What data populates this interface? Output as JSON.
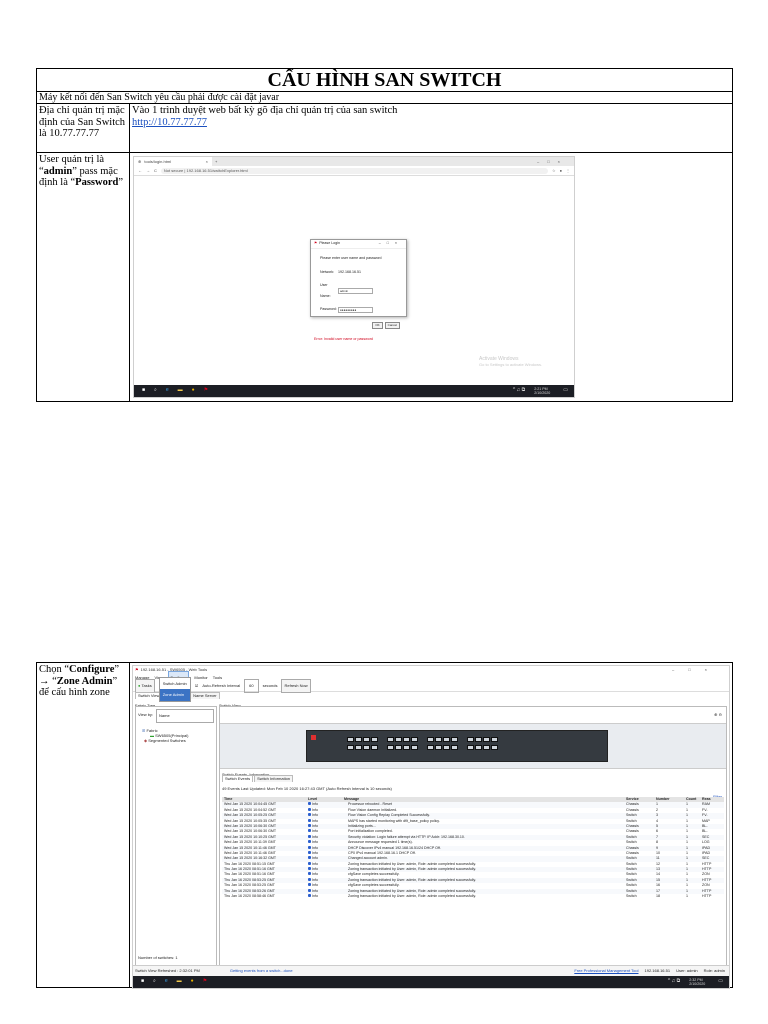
{
  "doc": {
    "title": "CẤU HÌNH SAN SWITCH",
    "note": "Máy kết nối đến San Switch yêu cầu phải được cài đặt javar",
    "row1": {
      "left": "Địa chỉ quản trị mặc định của San Switch là 10.77.77.77",
      "right": "Vào 1 trình duyệt web bất kỳ gõ địa chỉ quản trị của san switch",
      "link": "http://10.77.77.77"
    },
    "row2": {
      "left_pre": "User quản trị là “",
      "left_user": "admin",
      "left_mid": "” pass mặc định là “",
      "left_pass": "Password",
      "left_post": "”"
    },
    "row3": {
      "left_pre": "Chọn “",
      "left_cfg": "Configure",
      "left_mid": "” → “",
      "left_zone": "Zone Admin",
      "left_post": "” để cấu hình zone"
    }
  },
  "browser": {
    "tab_title": "tools/login.html",
    "address": "Not secure | 192.168.16.51/switchExplorer.html",
    "dialog_title": "Please Login",
    "dialog_prompt": "Please enter user name and password",
    "network_label": "Network:",
    "network_value": "192.168.16.51",
    "user_label": "User Name:",
    "user_value": "admin",
    "pass_label": "Password:",
    "pass_value": "●●●●●●●●●",
    "ok": "OK",
    "cancel": "Cancel",
    "error": "Error: Invalid user name or password",
    "activate_1": "Activate Windows",
    "activate_2": "Go to Settings to activate Windows.",
    "clock": "2:21 PM",
    "date": "2/10/2020"
  },
  "webtools": {
    "title": "192.168.16.51 - SW6505 - Web Tools",
    "menu": [
      "Manage",
      "View",
      "Configure",
      "Monitor",
      "Tools"
    ],
    "dropdown": [
      "Switch Admin",
      "Zone Admin"
    ],
    "tasks": "Tasks",
    "auto_refresh": "Auto-Refresh Interval",
    "interval": "60",
    "seconds": "seconds",
    "refresh_now": "Refresh Now",
    "view_tabs": [
      "Switch View",
      "Port Admin",
      "Name Server"
    ],
    "fabric_tree": "Fabric Tree",
    "view_by": "View by:",
    "view_by_value": "Name",
    "tree": [
      "Fabric",
      "SW6505(Principal)",
      "Segmented Switches"
    ],
    "switch_view": "Switch View",
    "events_panel": "Switch Events, Information",
    "event_tabs": [
      "Switch Events",
      "Switch Information"
    ],
    "events_summary": "49 Events   Last Updated: Mon Feb 10 2020 16:27:43 GMT (Auto Refresh Interval is 10 seconds)",
    "filter": "Filter",
    "columns": [
      "Time",
      "Level",
      "Message",
      "Service",
      "Number",
      "Count",
      "Reas"
    ],
    "rows": [
      [
        "Wed Jan 15 2020 10:04:45 GMT",
        "Info",
        "Processor rebooted - Reset",
        "Chassis",
        "1",
        "1",
        "RAM"
      ],
      [
        "Wed Jan 15 2020 10:04:52 GMT",
        "Info",
        "Flow Vision daemon initialized.",
        "Chassis",
        "2",
        "1",
        "FV-"
      ],
      [
        "Wed Jan 15 2020 10:05:25 GMT",
        "Info",
        "Flow Vision Config Replay Completed Successfully.",
        "Switch",
        "3",
        "1",
        "FV-"
      ],
      [
        "Wed Jan 15 2020 10:05:35 GMT",
        "Info",
        "MAPS has started monitoring with dflt_base_policy policy.",
        "Switch",
        "4",
        "1",
        "MAP"
      ],
      [
        "Wed Jan 15 2020 10:06:30 GMT",
        "Info",
        "Initializing ports...",
        "Chassis",
        "5",
        "1",
        "BL-"
      ],
      [
        "Wed Jan 15 2020 10:06:30 GMT",
        "Info",
        "Port initialization completed.",
        "Chassis",
        "6",
        "1",
        "BL-"
      ],
      [
        "Wed Jan 15 2020 10:10:25 GMT",
        "Info",
        "Security violation: Login failure attempt via HTTP. IP Addr: 192.168.30.10.",
        "Switch",
        "7",
        "1",
        "SEC"
      ],
      [
        "Wed Jan 15 2020 10:11:39 GMT",
        "Info",
        "Announce message requested 1 time(s).",
        "Switch",
        "8",
        "1",
        "LOG"
      ],
      [
        "Wed Jan 15 2020 10:11:46 GMT",
        "Info",
        "DHCP Discover IPv4 manual 192.168.16.51/24 DHCP Off.",
        "Chassis",
        "9",
        "1",
        "IPAD"
      ],
      [
        "Wed Jan 15 2020 10:11:46 GMT",
        "Info",
        "CP0 IPv4 manual 192.168.16.1 DHCP Off.",
        "Chassis",
        "10",
        "1",
        "IPAD"
      ],
      [
        "Wed Jan 15 2020 10:16:32 GMT",
        "Info",
        "Changed account admin.",
        "Switch",
        "11",
        "1",
        "SEC"
      ],
      [
        "Thu Jan 16 2020 08:51:15 GMT",
        "Info",
        "Zoning transaction initiated by User: admin, Role: admin completed successfully.",
        "Switch",
        "12",
        "1",
        "HTTP"
      ],
      [
        "Thu Jan 16 2020 08:51:16 GMT",
        "Info",
        "Zoning transaction initiated by User: admin, Role: admin completed successfully.",
        "Switch",
        "13",
        "1",
        "HTTP"
      ],
      [
        "Thu Jan 16 2020 08:51:16 GMT",
        "Info",
        "cfgSave completes successfully.",
        "Switch",
        "14",
        "1",
        "ZON"
      ],
      [
        "Thu Jan 16 2020 08:53:25 GMT",
        "Info",
        "Zoning transaction initiated by User: admin, Role: admin completed successfully.",
        "Switch",
        "15",
        "1",
        "HTTP"
      ],
      [
        "Thu Jan 16 2020 08:53:25 GMT",
        "Info",
        "cfgSave completes successfully.",
        "Switch",
        "16",
        "1",
        "ZON"
      ],
      [
        "Thu Jan 16 2020 08:53:26 GMT",
        "Info",
        "Zoning transaction initiated by User: admin, Role: admin completed successfully.",
        "Switch",
        "17",
        "1",
        "HTTP"
      ],
      [
        "Thu Jan 16 2020 08:58:46 GMT",
        "Info",
        "Zoning transaction initiated by User: admin, Role: admin completed successfully.",
        "Switch",
        "18",
        "1",
        "HTTP"
      ]
    ],
    "num_switches": "Number of switches:  1",
    "getting_events": "Getting events from a switch...done",
    "refreshed": "Switch View Refreshed : 2:32:01 PM",
    "status_tool": "Free Professional Management Tool",
    "status_ip": "192.168.16.51",
    "status_user": "User: admin",
    "status_role": "Role: admin",
    "clock": "2:32 PM",
    "date": "2/10/2020"
  },
  "colors": {
    "link": "#1a4fbf",
    "error": "#d0021b",
    "taskbar": "#1c1e24",
    "chassis": "#353a40"
  }
}
